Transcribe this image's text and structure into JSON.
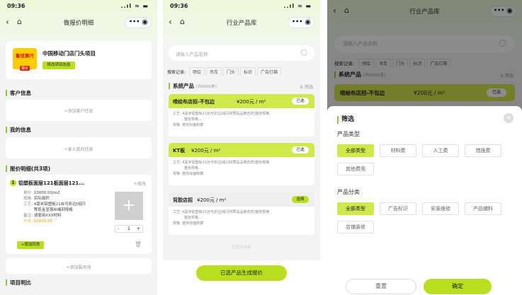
{
  "p1": {
    "time": "09:36",
    "signal": "..ıl ≈ ▬",
    "title": "做报价明细",
    "project_name": "中国移动门店门头项目",
    "edit_btn": "修改项目信息",
    "logo_line1": "鲁班算尺",
    "logo_line2": "报价",
    "customer_title": "客户信息",
    "customer_hint": "+添加客户信息",
    "my_title": "我的信息",
    "my_hint": "+录入我的信息",
    "detail_title": "报价明细(共3项)",
    "item_num": "1",
    "item_name": "铝塑板面层121板面层121...",
    "edit_link": "修改",
    "rows": [
      {
        "k": "单价:",
        "v": "10000.00/m2"
      },
      {
        "k": "规格:",
        "v": "实际面积"
      },
      {
        "k": "工艺:",
        "v": "4毫米铝塑板21丝可折边|组闪"
      },
      {
        "k": "",
        "v": "等现金显钢丝绳刻规格"
      },
      {
        "k": "备注:",
        "v": "请使用XXX材料"
      },
      {
        "k": "小计:",
        "v": "10000.00"
      }
    ],
    "qty": "1",
    "minus": "-",
    "plus": "+",
    "add_similar": "+增加同类",
    "add_service": "+添加服务项",
    "footer": "项目明比"
  },
  "p2": {
    "time": "09:36",
    "signal": "..ıl ≈ ▬",
    "title": "行业产品库",
    "search_placeholder": "请输入产品名称",
    "history_label": "搜索记录:",
    "history": [
      "喷绘",
      "吊车",
      "门头",
      "标识",
      "广告灯箱"
    ],
    "sys_label": "系统产品",
    "sys_count": "(共6000条)",
    "filter": "筛选",
    "products": [
      {
        "name": "喷绘布店招-不包边",
        "price": "¥200元 / m²",
        "btn": "已选",
        "l1": "工艺: 4毫米铝塑板21丝可折边|组闪材质是品牌吉祥|整张规格",
        "l2": "整张规格...",
        "l3": "规格: 按实际面积算"
      },
      {
        "name": "KT板",
        "price": "¥200元 / m²",
        "btn": "已选",
        "l1": "工艺: 4毫米铝塑板21丝可折边|组闪材质是品牌吉祥|整张规格",
        "l2": "整张规格...",
        "l3": "规格: 按实际面积算"
      },
      {
        "name": "背胶店招",
        "price": "¥200元 / m²",
        "btn": "选择",
        "l1": "工艺: 4毫米铝塑板21丝可折边|组闪材质是品牌吉祥|整张规格",
        "l2": "整张规格...",
        "l3": "规格: 按实际面积算"
      }
    ],
    "end": "已显示全部",
    "generate": "已选产品生成报价"
  },
  "p3": {
    "title": "行业产品库",
    "search_placeholder": "请输入产品名称",
    "history_label": "搜索记录:",
    "history": [
      "喷绘",
      "吊车",
      "门头",
      "标识",
      "广告灯箱"
    ],
    "sys_label": "系统产品",
    "sys_count": "(共6000条)",
    "filter": "筛选",
    "product_name": "喷绘布店招-不包边",
    "price": "¥200元 / m²",
    "btn": "已选",
    "sheet_title": "筛选",
    "type_label": "产品类型",
    "types": [
      "全部类型",
      "材料费",
      "人工费",
      "措施费",
      "其他费用"
    ],
    "cat_label": "产品分类",
    "cats": [
      "全部类型",
      "广告标识",
      "安装维修",
      "产品辅料",
      "店铺装修"
    ],
    "reset": "重置",
    "confirm": "确定"
  }
}
